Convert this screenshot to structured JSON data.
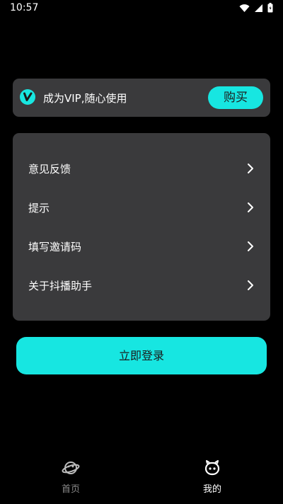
{
  "status_bar": {
    "time": "10:57",
    "icons": [
      "wifi-icon",
      "signal-icon",
      "battery-icon"
    ]
  },
  "vip_banner": {
    "text": "成为VIP,随心使用",
    "buy_label": "购买",
    "logo_icon": "app-logo-icon"
  },
  "menu": {
    "items": [
      {
        "label": "意见反馈",
        "icon": "chevron-right-icon"
      },
      {
        "label": "提示",
        "icon": "chevron-right-icon"
      },
      {
        "label": "填写邀请码",
        "icon": "chevron-right-icon"
      },
      {
        "label": "关于抖播助手",
        "icon": "chevron-right-icon"
      }
    ]
  },
  "login_button": {
    "label": "立即登录"
  },
  "bottom_nav": {
    "items": [
      {
        "label": "首页",
        "icon": "planet-icon",
        "active": false
      },
      {
        "label": "我的",
        "icon": "profile-face-icon",
        "active": true
      }
    ]
  },
  "colors": {
    "background": "#000000",
    "card": "#3a3a3c",
    "accent": "#17e6e1",
    "inactive_text": "#8a8a8a"
  }
}
